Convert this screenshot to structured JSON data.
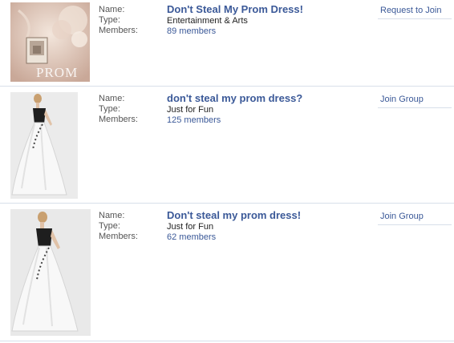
{
  "labels": {
    "name": "Name:",
    "type": "Type:",
    "members": "Members:"
  },
  "groups": [
    {
      "thumbnail_text": "PROM",
      "name": "Don't Steal My Prom Dress!",
      "type": "Entertainment & Arts",
      "members": "89 members",
      "action": "Request to Join"
    },
    {
      "name": "don't steal my prom dress?",
      "type": "Just for Fun",
      "members": "125 members",
      "action": "Join Group"
    },
    {
      "name": "Don't steal my prom dress!",
      "type": "Just for Fun",
      "members": "62 members",
      "action": "Join Group"
    }
  ],
  "colors": {
    "link": "#3b5998",
    "divider": "#d8dfea"
  }
}
